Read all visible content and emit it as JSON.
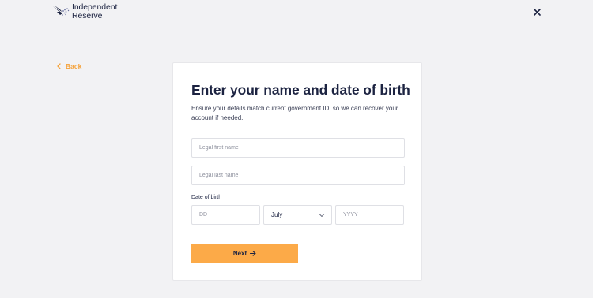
{
  "header": {
    "logo": {
      "line1": "Independent",
      "line2": "Reserve",
      "icon": "eagle-logo-icon"
    },
    "close_icon": "close-icon"
  },
  "nav": {
    "back_label": "Back",
    "back_icon": "chevron-left-icon"
  },
  "form": {
    "title": "Enter your name and date of birth",
    "subtitle": "Ensure your details match current government ID, so we can recover your account if needed.",
    "first_name_placeholder": "Legal first name",
    "last_name_placeholder": "Legal last name",
    "dob_label": "Date of birth",
    "day_placeholder": "DD",
    "month_value": "July",
    "month_icon": "chevron-down-icon",
    "year_placeholder": "YYYY",
    "next_label": "Next",
    "next_icon": "arrow-right-icon"
  },
  "colors": {
    "accent": "#fcaa48",
    "link": "#f5a23a",
    "text": "#1c2341",
    "background": "#f2f2f4"
  }
}
